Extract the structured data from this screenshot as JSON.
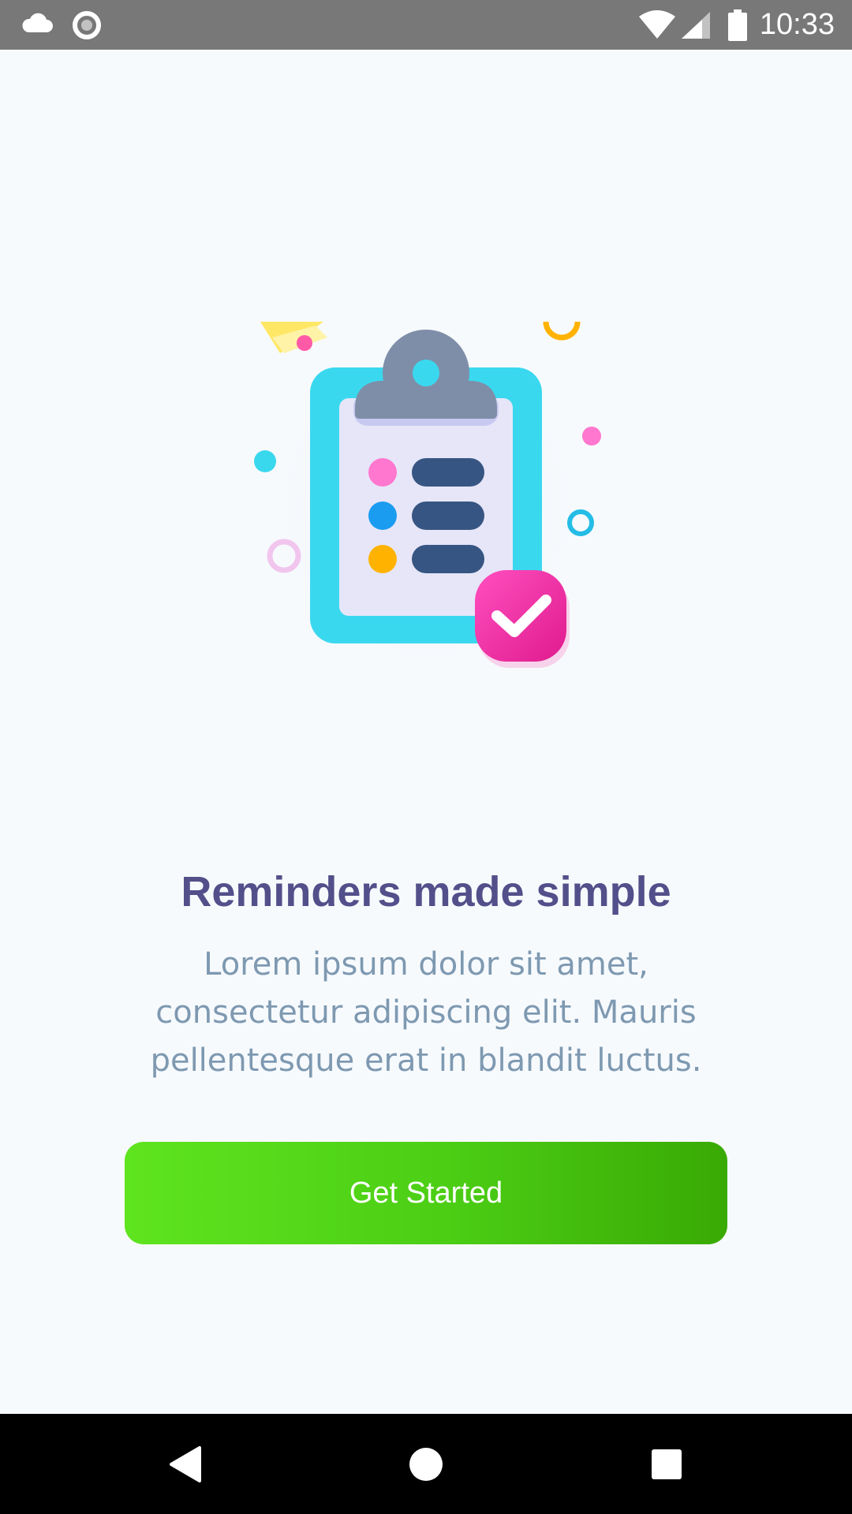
{
  "status_bar": {
    "time": "10:33",
    "icons": [
      "cloud-icon",
      "record-icon",
      "wifi-icon",
      "signal-icon",
      "battery-icon"
    ]
  },
  "onboarding": {
    "title": "Reminders made simple",
    "description": "Lorem ipsum dolor sit amet, consectetur adipiscing elit. Mauris pellentesque erat in blandit luctus.",
    "cta_label": "Get Started",
    "illustration_icon": "clipboard-checklist-illustration"
  },
  "nav_bar": {
    "icons": [
      "back-icon",
      "home-icon",
      "recents-icon"
    ]
  },
  "colors": {
    "title": "#534f8a",
    "description": "#7e99b1",
    "button_start": "#5fe41f",
    "button_end": "#39a904",
    "status_bar": "#787878",
    "nav_bar": "#000000",
    "background": "#f7fafd"
  }
}
